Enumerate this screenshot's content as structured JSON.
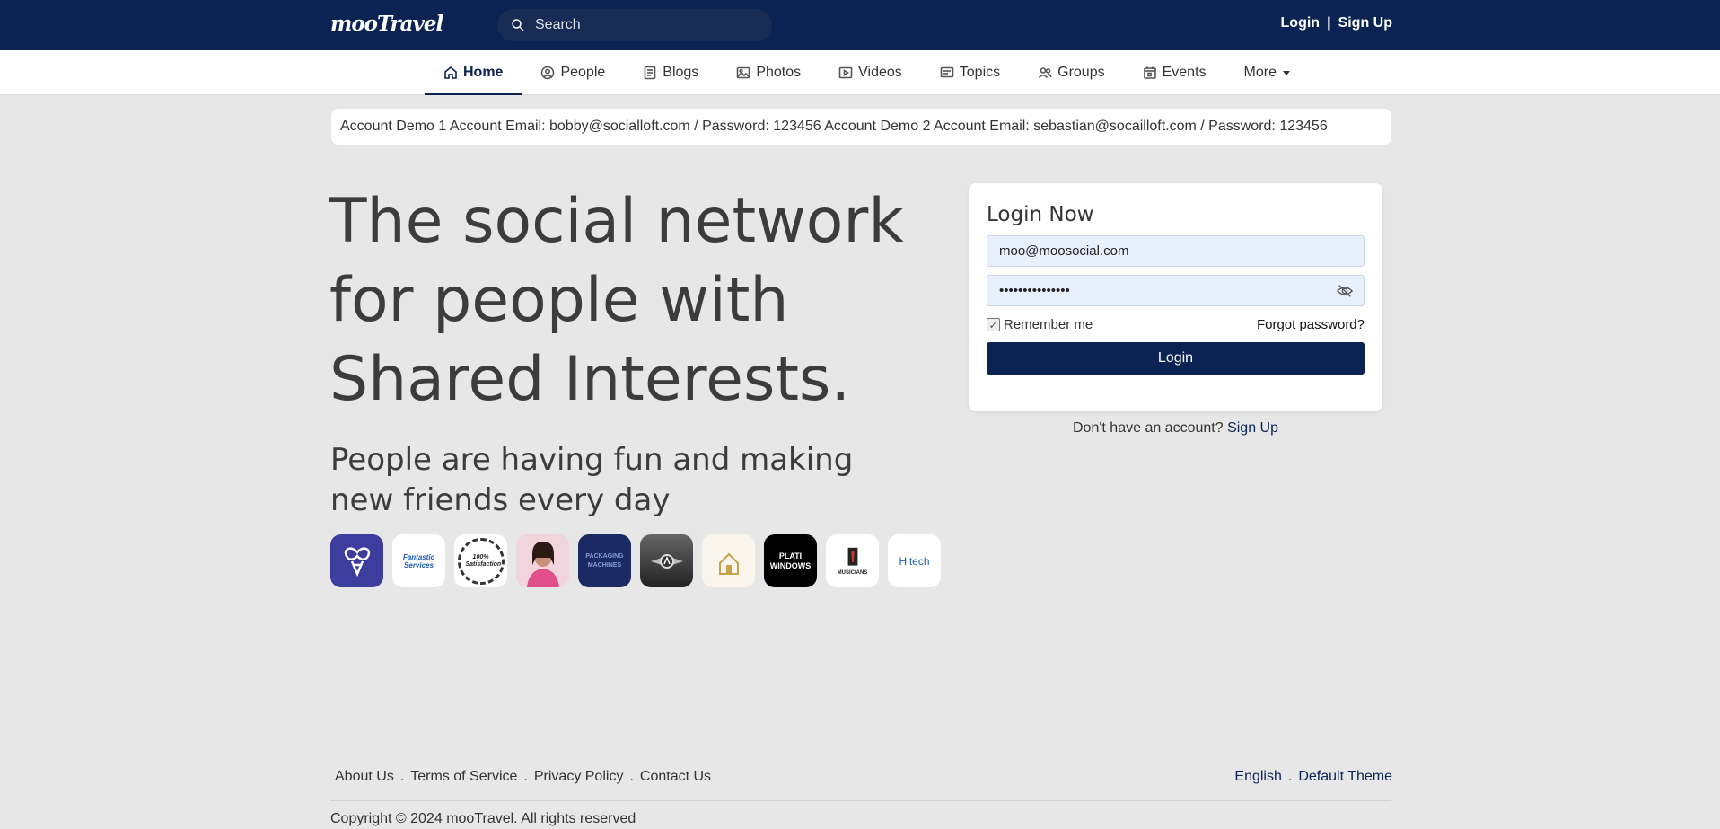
{
  "brand": {
    "logo_text": "mooTravel"
  },
  "search": {
    "placeholder": "Search"
  },
  "auth": {
    "login": "Login",
    "separator": "|",
    "signup": "Sign Up"
  },
  "nav": {
    "items": [
      {
        "label": "Home",
        "icon": "home-icon",
        "active": true
      },
      {
        "label": "People",
        "icon": "user-circle-icon"
      },
      {
        "label": "Blogs",
        "icon": "document-icon"
      },
      {
        "label": "Photos",
        "icon": "image-icon"
      },
      {
        "label": "Videos",
        "icon": "video-icon"
      },
      {
        "label": "Topics",
        "icon": "message-icon"
      },
      {
        "label": "Groups",
        "icon": "group-icon"
      },
      {
        "label": "Events",
        "icon": "calendar-icon"
      },
      {
        "label": "More",
        "icon": "caret-down-icon"
      }
    ]
  },
  "demo_notice": "Account Demo 1 Account Email: bobby@socialloft.com / Password: 123456 Account Demo 2 Account Email: sebastian@socailloft.com / Password: 123456",
  "hero": {
    "title": "The social network for people with Shared Interests.",
    "subtitle": "People are having fun and making new friends every day"
  },
  "avatars": [
    {
      "name": "bee-logo-avatar",
      "label": ""
    },
    {
      "name": "fantastic-services-avatar",
      "label": "Fantastic Services"
    },
    {
      "name": "satisfaction-badge-avatar",
      "label": "100% Satisfaction"
    },
    {
      "name": "woman-photo-avatar",
      "label": ""
    },
    {
      "name": "packaging-machines-avatar",
      "label": "PACKAGING MACHINES"
    },
    {
      "name": "car-emblem-avatar",
      "label": ""
    },
    {
      "name": "gold-house-avatar",
      "label": ""
    },
    {
      "name": "plati-windows-avatar",
      "label": "PLATI WINDOWS"
    },
    {
      "name": "musicians-avatar",
      "label": "MUSICIANS"
    },
    {
      "name": "hitech-avatar",
      "label": "Hitech"
    }
  ],
  "login": {
    "title": "Login Now",
    "email_value": "moo@moosocial.com",
    "password_value": "•••••••••••••••",
    "remember_label": "Remember me",
    "remember_checked": true,
    "forgot_label": "Forgot password?",
    "submit_label": "Login",
    "no_account_text": "Don't have an account?",
    "signup_link": "Sign Up"
  },
  "footer": {
    "links": [
      "About Us",
      "Terms of Service",
      "Privacy Policy",
      "Contact Us"
    ],
    "language": "English",
    "theme": "Default Theme",
    "copyright": "Copyright © 2024 mooTravel. All rights reserved"
  },
  "colors": {
    "primary": "#0b2353",
    "background": "#e7e7e7",
    "input_bg": "#e8f0fe"
  }
}
